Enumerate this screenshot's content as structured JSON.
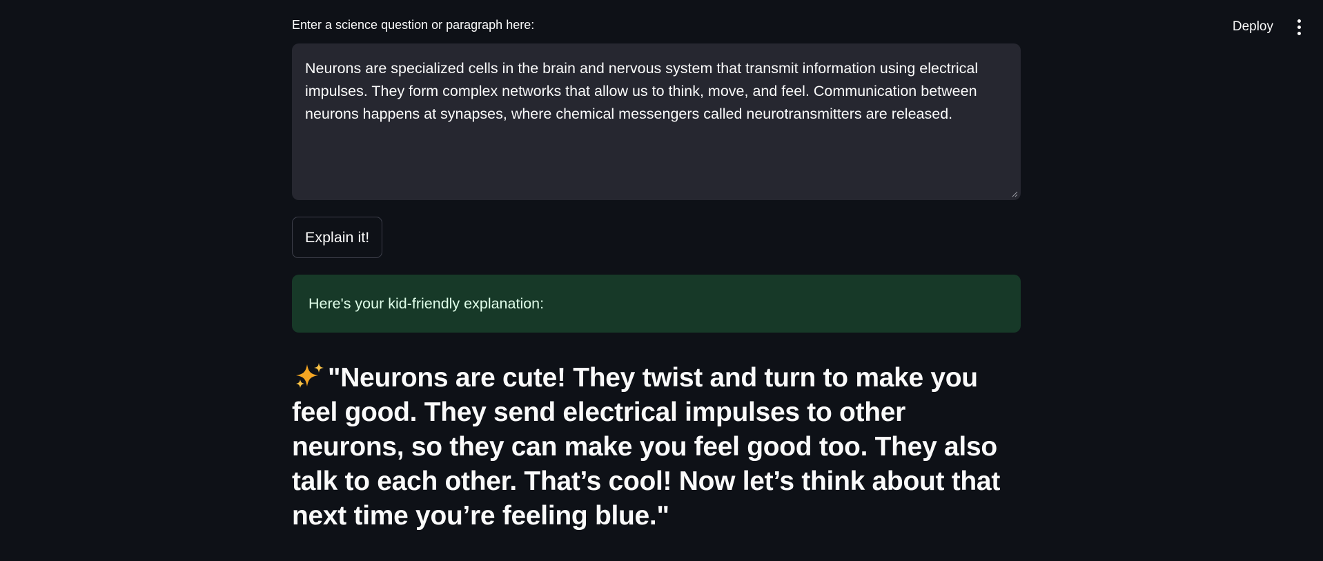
{
  "header": {
    "deploy_label": "Deploy",
    "menu_icon": "kebab-menu-icon"
  },
  "input": {
    "label": "Enter a science question or paragraph here:",
    "value": "Neurons are specialized cells in the brain and nervous system that transmit information using electrical impulses. They form complex networks that allow us to think, move, and feel. Communication between neurons happens at synapses, where chemical messengers called neurotransmitters are released."
  },
  "actions": {
    "explain_label": "Explain it!"
  },
  "result": {
    "success_message": "Here's your kid-friendly explanation:",
    "explanation_icon": "sparkles-icon",
    "explanation_text": "\"Neurons are cute! They twist and turn to make you feel good. They send electrical impulses to other neurons, so they can make you feel good too. They also talk to each other. That’s cool! Now let’s think about that next time you’re feeling blue.\""
  },
  "colors": {
    "background": "#0e1117",
    "textarea_bg": "#262730",
    "success_bg": "#173928",
    "success_text": "#dffde9",
    "text": "#fafafa"
  }
}
